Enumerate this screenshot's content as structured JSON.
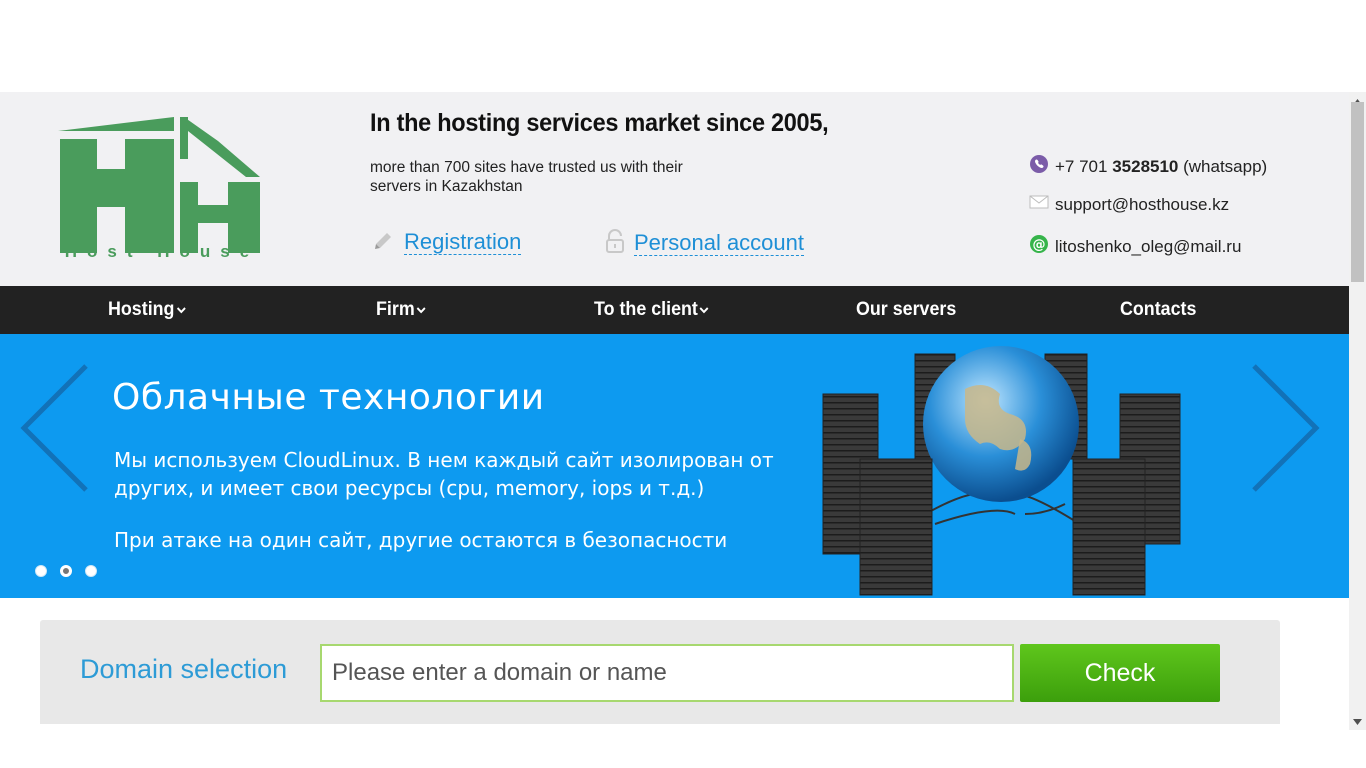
{
  "brand": {
    "logo_text": "Host House",
    "green": "#4a9c5c"
  },
  "header": {
    "tagline": "In the hosting services market since 2005,",
    "subtag": "more than 700 sites have trusted us with their servers in Kazakhstan",
    "registration_label": "Registration",
    "account_label": "Personal account",
    "contacts": {
      "phone_prefix": "+7 701 ",
      "phone_number": "3528510",
      "phone_suffix": " (whatsapp)",
      "email_support": "support@hosthouse.kz",
      "email_mail": "litoshenko_oleg@mail.ru"
    }
  },
  "nav": {
    "items": [
      {
        "label": "Hosting",
        "icon": "chevron-down-icon"
      },
      {
        "label": "Firm",
        "icon": "chevron-down-icon"
      },
      {
        "label": "To the client",
        "icon": "chevron-down-icon"
      },
      {
        "label": "Our servers"
      },
      {
        "label": "Contacts"
      }
    ]
  },
  "banner": {
    "title": "Облачные технологии",
    "text": "Мы используем CloudLinux. В нем каждый сайт изолирован от других, и имеет свои ресурсы (cpu, memory, iops и т.д.)",
    "text2": "При атаке на один сайт, другие остаются в безопасности",
    "active_slide": 2,
    "slides": 3,
    "accent": "#0d9af0"
  },
  "domain": {
    "label": "Domain selection",
    "placeholder": "Please enter a domain or name",
    "value": "",
    "button": "Check"
  }
}
